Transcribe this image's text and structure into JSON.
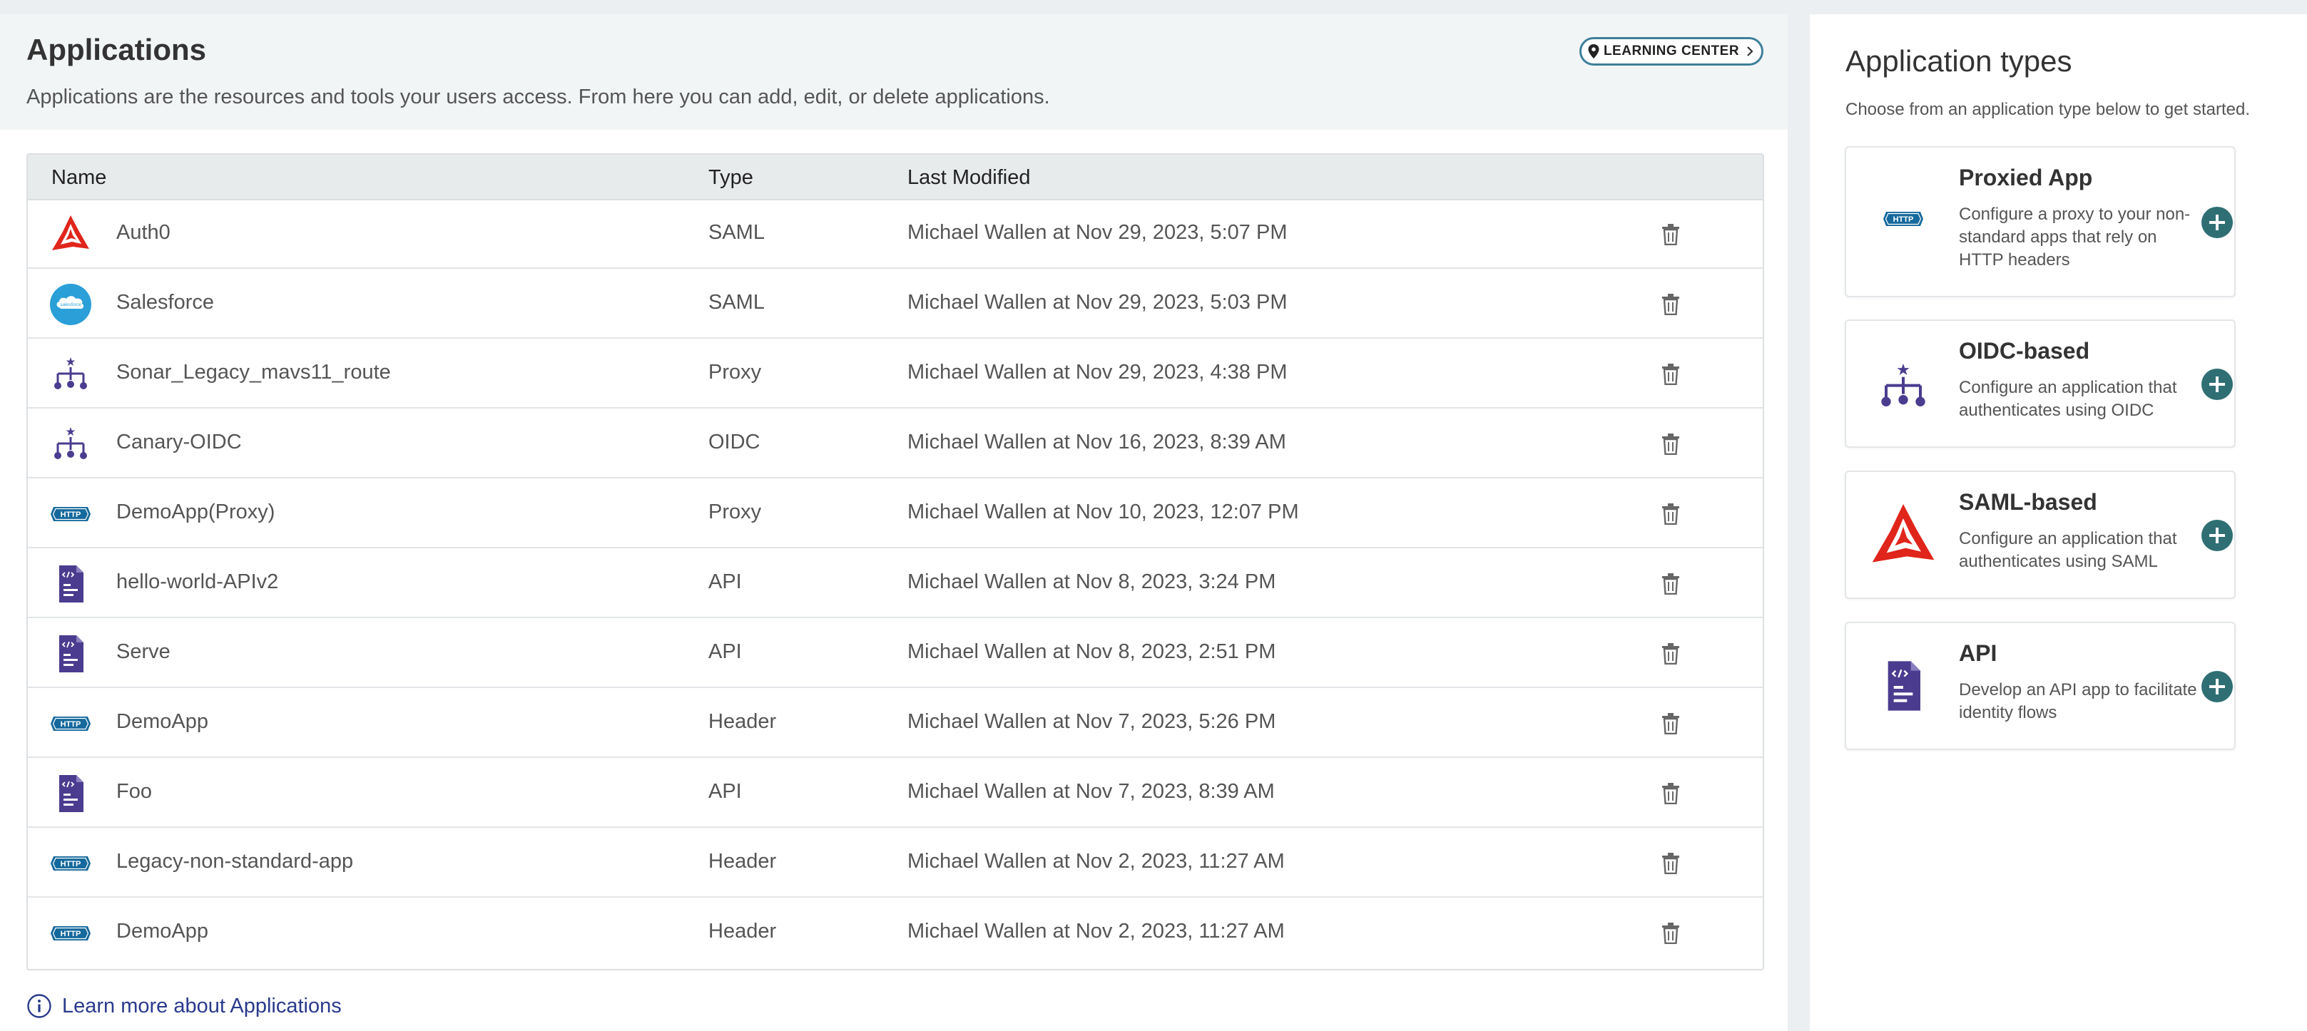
{
  "header": {
    "title": "Applications",
    "description": "Applications are the resources and tools your users access. From here you can add, edit, or delete applications.",
    "learning_center_label": "LEARNING CENTER"
  },
  "table": {
    "columns": {
      "name": "Name",
      "type": "Type",
      "modified": "Last Modified"
    },
    "rows": [
      {
        "icon": "auth0-logo-icon",
        "name": "Auth0",
        "type": "SAML",
        "modified": "Michael Wallen at Nov 29, 2023, 5:07 PM"
      },
      {
        "icon": "salesforce-logo-icon",
        "name": "Salesforce",
        "type": "SAML",
        "modified": "Michael Wallen at Nov 29, 2023, 5:03 PM"
      },
      {
        "icon": "oidc-icon",
        "name": "Sonar_Legacy_mavs11_route",
        "type": "Proxy",
        "modified": "Michael Wallen at Nov 29, 2023, 4:38 PM"
      },
      {
        "icon": "oidc-icon",
        "name": "Canary-OIDC",
        "type": "OIDC",
        "modified": "Michael Wallen at Nov 16, 2023, 8:39 AM"
      },
      {
        "icon": "http-icon",
        "name": "DemoApp(Proxy)",
        "type": "Proxy",
        "modified": "Michael Wallen at Nov 10, 2023, 12:07 PM"
      },
      {
        "icon": "api-document-icon",
        "name": "hello-world-APIv2",
        "type": "API",
        "modified": "Michael Wallen at Nov 8, 2023, 3:24 PM"
      },
      {
        "icon": "api-document-icon",
        "name": "Serve",
        "type": "API",
        "modified": "Michael Wallen at Nov 8, 2023, 2:51 PM"
      },
      {
        "icon": "http-icon",
        "name": "DemoApp",
        "type": "Header",
        "modified": "Michael Wallen at Nov 7, 2023, 5:26 PM"
      },
      {
        "icon": "api-document-icon",
        "name": "Foo",
        "type": "API",
        "modified": "Michael Wallen at Nov 7, 2023, 8:39 AM"
      },
      {
        "icon": "http-icon",
        "name": "Legacy-non-standard-app",
        "type": "Header",
        "modified": "Michael Wallen at Nov 2, 2023, 11:27 AM"
      },
      {
        "icon": "http-icon",
        "name": "DemoApp",
        "type": "Header",
        "modified": "Michael Wallen at Nov 2, 2023, 11:27 AM"
      }
    ]
  },
  "footer": {
    "learn_more": "Learn more about Applications"
  },
  "sidebar": {
    "title": "Application types",
    "description": "Choose from an application type below to get started.",
    "cards": [
      {
        "icon": "http-icon",
        "title": "Proxied App",
        "description": "Configure a proxy to your non-standard apps that rely on HTTP headers"
      },
      {
        "icon": "oidc-icon",
        "title": "OIDC-based",
        "description": "Configure an application that authenticates using OIDC"
      },
      {
        "icon": "auth0-logo-icon",
        "title": "SAML-based",
        "description": "Configure an application that authenticates using SAML"
      },
      {
        "icon": "api-document-icon",
        "title": "API",
        "description": "Develop an API app to facilitate identity flows"
      }
    ]
  },
  "icon_labels": {
    "http": "HTTP",
    "salesforce": "salesforce"
  },
  "colors": {
    "accent_teal": "#2f6f74",
    "auth0_red": "#e0251b",
    "oidc_purple": "#4b3c8f",
    "http_blue": "#15699c",
    "salesforce_blue": "#2a9fd8",
    "link_blue": "#2a3a8c"
  }
}
